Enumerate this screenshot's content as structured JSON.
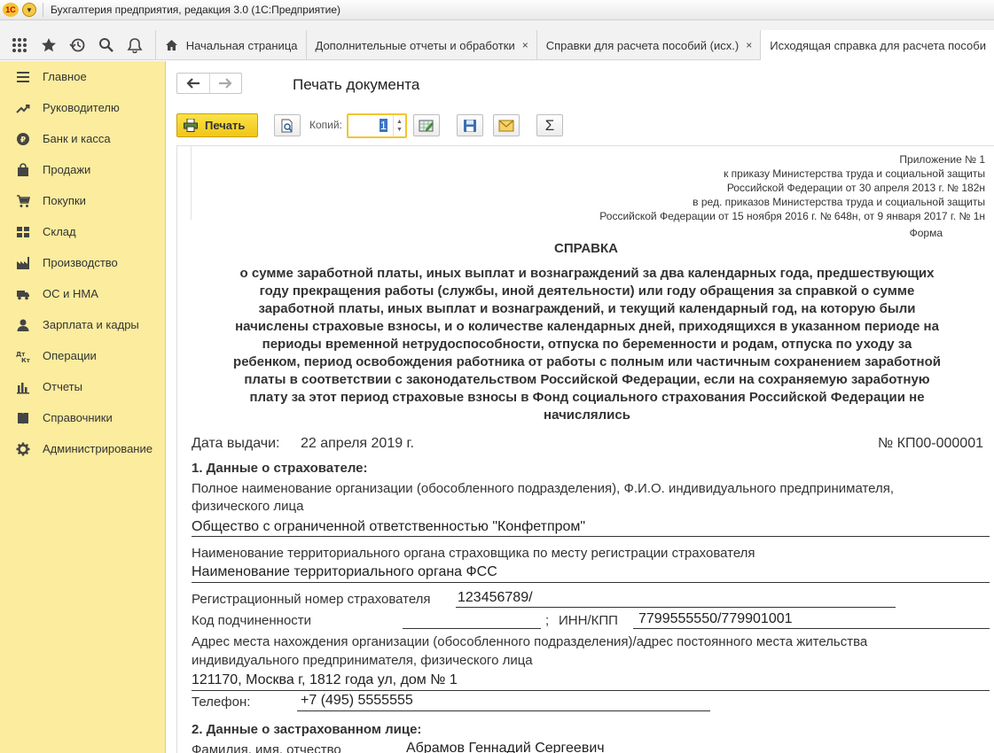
{
  "window": {
    "logo": "1С",
    "title": "Бухгалтерия предприятия, редакция 3.0  (1С:Предприятие)"
  },
  "nav_icons": [
    "apps-grid-icon",
    "star-icon",
    "history-icon",
    "search-icon",
    "bell-icon"
  ],
  "tabs": [
    {
      "label": "Начальная страница",
      "icon": "home-icon",
      "closable": false
    },
    {
      "label": "Дополнительные отчеты и обработки",
      "closable": true
    },
    {
      "label": "Справки для расчета пособий (исх.)",
      "closable": true
    },
    {
      "label": "Исходящая справка для расчета пособи",
      "closable": false,
      "active": true
    }
  ],
  "tab_close_glyph": "×",
  "sidebar": {
    "items": [
      {
        "label": "Главное",
        "icon": "menu-lines-icon"
      },
      {
        "label": "Руководителю",
        "icon": "trend-up-icon"
      },
      {
        "label": "Банк и касса",
        "icon": "coin-icon"
      },
      {
        "label": "Продажи",
        "icon": "shopping-bag-icon"
      },
      {
        "label": "Покупки",
        "icon": "cart-icon"
      },
      {
        "label": "Склад",
        "icon": "warehouse-grid-icon"
      },
      {
        "label": "Производство",
        "icon": "factory-icon"
      },
      {
        "label": "ОС и НМА",
        "icon": "truck-icon"
      },
      {
        "label": "Зарплата и кадры",
        "icon": "person-icon"
      },
      {
        "label": "Операции",
        "icon": "debit-credit-icon"
      },
      {
        "label": "Отчеты",
        "icon": "bar-chart-icon"
      },
      {
        "label": "Справочники",
        "icon": "book-icon"
      },
      {
        "label": "Администрирование",
        "icon": "gear-icon"
      }
    ]
  },
  "page": {
    "title": "Печать документа"
  },
  "toolbar": {
    "print_label": "Печать",
    "copies_label": "Копий:",
    "copies_value": "1",
    "sum_glyph": "Σ"
  },
  "document": {
    "appendix": [
      "Приложение № 1",
      "к приказу Министерства труда и социальной защиты",
      "Российской Федерации от 30 апреля 2013 г. № 182н",
      "в ред. приказов Министерства труда и социальной защиты",
      "Российской Федерации от 15 ноября 2016 г. № 648н, от 9 января 2017 г. № 1н"
    ],
    "forma": "Форма",
    "heading": "СПРАВКА",
    "subject_lines": [
      "о сумме заработной платы, иных выплат и вознаграждений за два календарных года, предшествующих",
      "году прекращения работы (службы, иной деятельности) или году обращения за справкой о сумме",
      "заработной платы, иных выплат и вознаграждений, и текущий календарный год, на которую были",
      "начислены страховые взносы, и о количестве календарных дней, приходящихся в указанном периоде на",
      "периоды временной нетрудоспособности, отпуска по беременности и родам, отпуска по уходу за",
      "ребенком, период освобождения работника от работы с полным или частичным сохранением заработной",
      "платы в соответствии с законодательством Российской Федерации, если на сохраняемую заработную",
      "плату за этот период страховые взносы в Фонд социального страхования Российской Федерации не",
      "начислялись"
    ],
    "issue_date_label": "Дата выдачи:",
    "issue_date": "22 апреля 2019 г.",
    "number": "№ КП00-000001",
    "section1_title": "1. Данные о страхователе:",
    "org_name_label_1": "Полное наименование организации (обособленного подразделения), Ф.И.О.  индивидуального предпринимателя,",
    "org_name_label_2": "физического лица",
    "org_name": "Общество с ограниченной ответственностью \"Конфетпром\"",
    "fss_label": "Наименование территориального органа страховщика по месту регистрации страхователя",
    "fss_value": "Наименование территориального органа ФСС",
    "reg_label": "Регистрационный номер страхователя",
    "reg_value": "123456789/",
    "subord_label": "Код подчиненности",
    "semicolon": ";",
    "inn_label": "ИНН/КПП",
    "inn_value": "7799555550/779901001",
    "address_label_1": "Адрес места нахождения организации (обособленного подразделения)/адрес постоянного места жительства",
    "address_label_2": "индивидуального предпринимателя, физического лица",
    "address_value": "121170, Москва г, 1812 года ул, дом № 1",
    "phone_label": "Телефон:",
    "phone_value": "+7 (495) 5555555",
    "section2_title": "2. Данные о застрахованном лице:",
    "fio_label": "Фамилия, имя, отчество",
    "fio_value": "Абрамов Геннадий Сергеевич"
  },
  "colors": {
    "sidebar": "#fbec9e",
    "print_button": "#f1c516",
    "accent_border": "#f3c52b"
  }
}
